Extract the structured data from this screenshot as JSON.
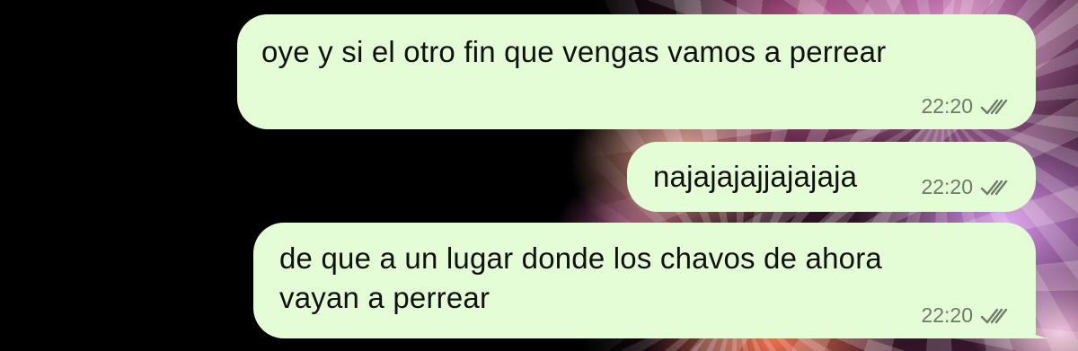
{
  "colors": {
    "bubble_outgoing": "#e4fdd6",
    "meta_text": "#6f7a6a"
  },
  "messages": [
    {
      "text": "oye y si el otro fin que vengas vamos a perrear",
      "time": "22:20",
      "status_icon": "double-check-icon"
    },
    {
      "text": "najajajajjajajaja",
      "time": "22:20",
      "status_icon": "double-check-icon"
    },
    {
      "text_line1": "de que a un lugar donde los chavos de ahora",
      "text_line2": "vayan a perrear",
      "time": "22:20",
      "status_icon": "double-check-icon"
    }
  ]
}
